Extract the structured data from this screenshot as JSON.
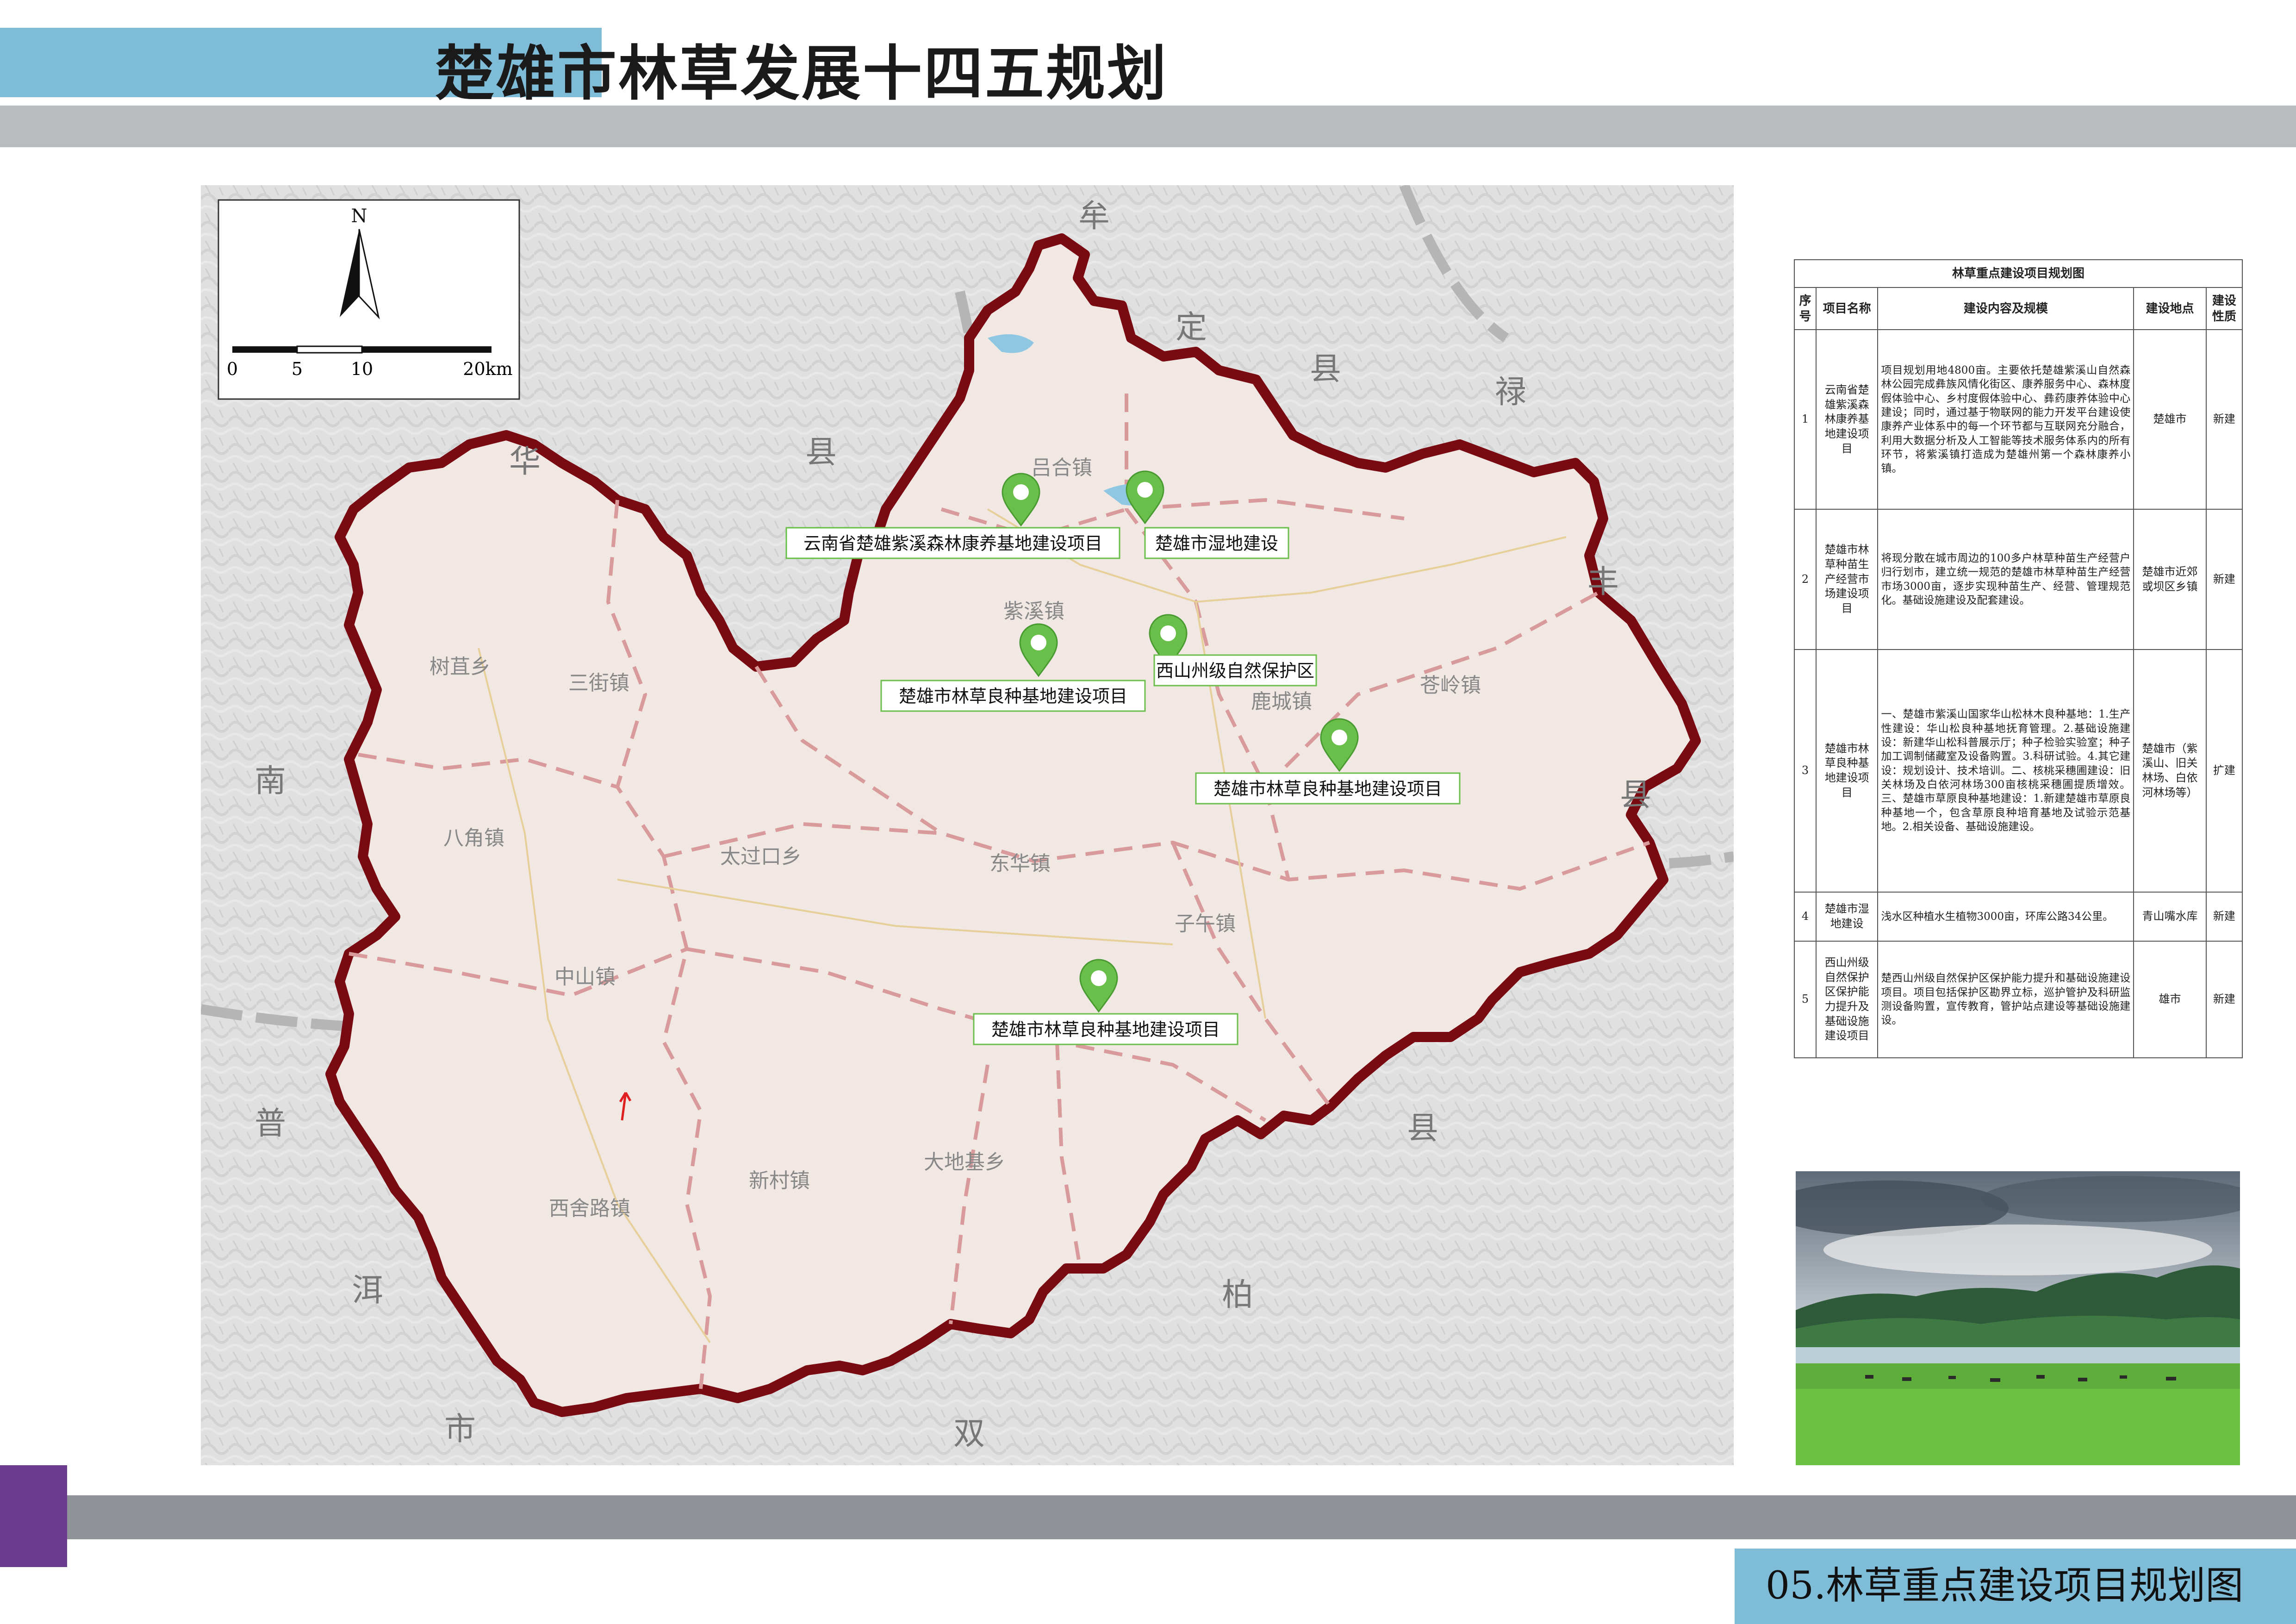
{
  "header": {
    "title": "楚雄市林草发展十四五规划"
  },
  "footer": {
    "title": "05.林草重点建设项目规划图"
  },
  "map": {
    "north_label": "N",
    "scale_labels": [
      "0",
      "5",
      "10",
      "20km"
    ],
    "neighbor_labels": {
      "mouding": [
        "牟",
        "定",
        "县"
      ],
      "lufeng": [
        "禄",
        "丰",
        "县"
      ],
      "nanhua": [
        "华",
        "县",
        "南"
      ],
      "puer": [
        "普",
        "洱",
        "市"
      ],
      "shuangbai": [
        "双",
        "柏",
        "县"
      ]
    },
    "towns": [
      "吕合镇",
      "紫溪镇",
      "树苴乡",
      "三街镇",
      "八角镇",
      "太过口乡",
      "东华镇",
      "鹿城镇",
      "苍岭镇",
      "子午镇",
      "中山镇",
      "新村镇",
      "大地基乡",
      "西舍路镇"
    ],
    "projects": [
      "云南省楚雄紫溪森林康养基地建设项目",
      "楚雄市湿地建设",
      "楚雄市林草良种基地建设项目",
      "西山州级自然保护区",
      "楚雄市林草良种基地建设项目",
      "楚雄市林草良种基地建设项目"
    ],
    "colors": {
      "boundary": "#7a0a12",
      "fill": "#f1e8e4",
      "marker": "#6abf4b",
      "town_line": "#d89a9a"
    }
  },
  "table": {
    "title": "林草重点建设项目规划图",
    "headers": [
      "序号",
      "项目名称",
      "建设内容及规模",
      "建设地点",
      "建设性质"
    ],
    "rows": [
      {
        "no": "1",
        "name": "云南省楚雄紫溪森林康养基地建设项目",
        "content": "项目规划用地4800亩。主要依托楚雄紫溪山自然森林公园完成彝族风情化街区、康养服务中心、森林度假体验中心、乡村度假体验中心、彝药康养体验中心建设；同时，通过基于物联网的能力开发平台建设使康养产业体系中的每一个环节都与互联网充分融合，利用大数据分析及人工智能等技术服务体系内的所有环节，将紫溪镇打造成为楚雄州第一个森林康养小镇。",
        "location": "楚雄市",
        "type": "新建"
      },
      {
        "no": "2",
        "name": "楚雄市林草种苗生产经营市场建设项目",
        "content": "将现分散在城市周边的100多户林草种苗生产经营户归行划市，建立统一规范的楚雄市林草种苗生产经营市场3000亩，逐步实现种苗生产、经营、管理规范化。基础设施建设及配套建设。",
        "location": "楚雄市近郊或坝区乡镇",
        "type": "新建"
      },
      {
        "no": "3",
        "name": "楚雄市林草良种基地建设项目",
        "content": "一、楚雄市紫溪山国家华山松林木良种基地：1.生产性建设：华山松良种基地抚育管理。2.基础设施建设：新建华山松科普展示厅；种子检验实验室；种子加工调制储藏室及设备购置。3.科研试验。4.其它建设：规划设计、技术培训。二、核桃采穗圃建设：旧关林场及白依河林场300亩核桃采穗圃提质增效。三、楚雄市草原良种基地建设：1.新建楚雄市草原良种基地一个，包含草原良种培育基地及试验示范基地。2.相关设备、基础设施建设。",
        "location": "楚雄市（紫溪山、旧关林场、白依河林场等）",
        "type": "扩建"
      },
      {
        "no": "4",
        "name": "楚雄市湿地建设",
        "content": "浅水区种植水生植物3000亩，环库公路34公里。",
        "location": "青山嘴水库",
        "type": "新建"
      },
      {
        "no": "5",
        "name": "西山州级自然保护区保护能力提升及基础设施建设项目",
        "content": "楚西山州级自然保护区保护能力提升和基础设施建设项目。项目包括保护区勘界立标，巡护管护及科研监测设备购置，宣传教育，管护站点建设等基础设施建设。",
        "location": "雄市",
        "type": "新建"
      }
    ]
  }
}
